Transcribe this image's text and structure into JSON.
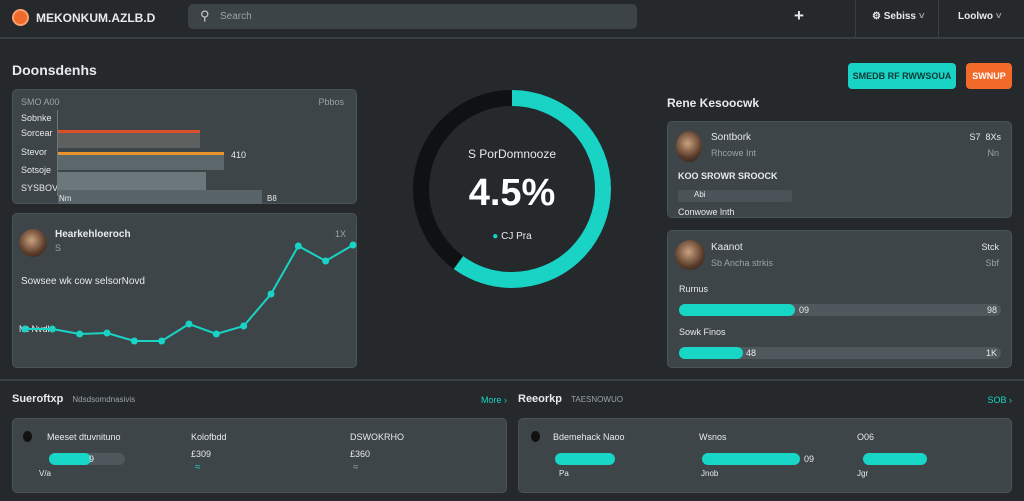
{
  "topbar": {
    "app_title": "MEKONKUM.AZLB.D",
    "search_placeholder": "Search",
    "add_icon": "plus-icon",
    "settings_label": "Sebiss",
    "user_label": "Loolwo"
  },
  "page": {
    "title": "Doonsdenhs",
    "primary_button": "SMEDB RF RWWSOUA",
    "secondary_button": "SWNUP",
    "accent": "#19d3c5",
    "accent_orange": "#f26a2a"
  },
  "bar_card": {
    "header_left": "SMO A00",
    "header_right": "Pbbos",
    "labels": [
      "Sobnke",
      "Sorcear",
      "Stevor",
      "Sotsoje",
      "SYSBOVE"
    ],
    "value_label": "410",
    "axis_left": "Nm",
    "axis_right": "B8",
    "values": [
      142,
      166,
      148,
      204
    ]
  },
  "line_card": {
    "name": "Hearkehloeroch",
    "sub": "S",
    "corner": "1X",
    "caption": "Sowsee wk cow selsorNovd",
    "axis_label": "Mt Nvdkt",
    "values": [
      25,
      25,
      20,
      21,
      13,
      13,
      30,
      20,
      28,
      60,
      108,
      93,
      109
    ]
  },
  "donut": {
    "label": "S PorDomnooze",
    "value": "4.5%",
    "legend": "CJ Pra",
    "progress": 0.6
  },
  "recent": {
    "title": "Rene Kesoocwk",
    "card1": {
      "name": "Sontbork",
      "sub": "Rhcowe Int",
      "right1": "S7  8Xs",
      "right2": "Nn",
      "heading": "KOO SROWR SROOCK",
      "chip": "Abi",
      "footer": "Conwowe lnth"
    },
    "card2": {
      "name": "Kaanot",
      "sub": "Sb Ancha strkis",
      "right1": "Stck",
      "right2": "Sbf",
      "rows": [
        {
          "label": "Rurnus",
          "value": "09",
          "end": "98",
          "fill": 0.36
        },
        {
          "label": "Sowk Finos",
          "value": "48",
          "end": "1K",
          "fill": 0.2
        }
      ]
    }
  },
  "bottom": [
    {
      "title": "Sueroftxp",
      "sub": "Ndsdsomdnasivis",
      "link": "More",
      "items": [
        {
          "name": "Meeset dtuvnituno",
          "fill": 0.55,
          "val": "9",
          "foot": "V/a"
        },
        {
          "name": "Kolofbdd",
          "amount": "£309"
        },
        {
          "name": "DSWOKRHO",
          "amount": "£360"
        }
      ]
    },
    {
      "title": "Reeorkp",
      "sub": "TAESNOWUO",
      "link": "SOB",
      "items": [
        {
          "name": "Bdemehack Naoo",
          "fill": 1,
          "foot": "Pa"
        },
        {
          "name": "Wsnos",
          "fill": 1,
          "val": "09",
          "foot": "Jnob"
        },
        {
          "name": "O06",
          "fill": 1,
          "foot": "Jgr"
        }
      ]
    }
  ]
}
